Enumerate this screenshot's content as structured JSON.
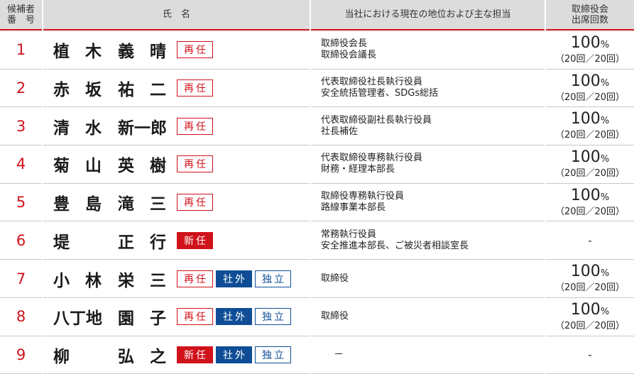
{
  "table": {
    "headers": {
      "number_line1": "候補者",
      "number_line2": "番　号",
      "name": "氏　名",
      "position": "当社における現在の地位および主な担当",
      "attendance_line1": "取締役会",
      "attendance_line2": "出席回数"
    },
    "rows": [
      {
        "no": "1",
        "name": [
          "植",
          "木",
          "義",
          "晴"
        ],
        "badges": [
          {
            "type": "reappoint",
            "label": "再任"
          }
        ],
        "position": [
          "取締役会長",
          "取締役会議長"
        ],
        "attendance": {
          "percent": "100",
          "unit": "%",
          "count": "（20回／20回）"
        }
      },
      {
        "no": "2",
        "name": [
          "赤",
          "坂",
          "祐",
          "二"
        ],
        "badges": [
          {
            "type": "reappoint",
            "label": "再任"
          }
        ],
        "position": [
          "代表取締役社長執行役員",
          "安全統括管理者、SDGs総括"
        ],
        "attendance": {
          "percent": "100",
          "unit": "%",
          "count": "（20回／20回）"
        }
      },
      {
        "no": "3",
        "name": [
          "清",
          "水",
          "新一郎"
        ],
        "badges": [
          {
            "type": "reappoint",
            "label": "再任"
          }
        ],
        "position": [
          "代表取締役副社長執行役員",
          "社長補佐"
        ],
        "attendance": {
          "percent": "100",
          "unit": "%",
          "count": "（20回／20回）"
        }
      },
      {
        "no": "4",
        "name": [
          "菊",
          "山",
          "英",
          "樹"
        ],
        "badges": [
          {
            "type": "reappoint",
            "label": "再任"
          }
        ],
        "position": [
          "代表取締役専務執行役員",
          "財務・経理本部長"
        ],
        "attendance": {
          "percent": "100",
          "unit": "%",
          "count": "（20回／20回）"
        }
      },
      {
        "no": "5",
        "name": [
          "豊",
          "島",
          "滝",
          "三"
        ],
        "badges": [
          {
            "type": "reappoint",
            "label": "再任"
          }
        ],
        "position": [
          "取締役専務執行役員",
          "路線事業本部長"
        ],
        "attendance": {
          "percent": "100",
          "unit": "%",
          "count": "（20回／20回）"
        }
      },
      {
        "no": "6",
        "name": [
          "堤",
          "",
          "正",
          "行"
        ],
        "badges": [
          {
            "type": "new",
            "label": "新任"
          }
        ],
        "position": [
          "常務執行役員",
          "安全推進本部長、ご被災者相談室長"
        ],
        "attendance": {
          "dash": "-"
        }
      },
      {
        "no": "7",
        "name": [
          "小",
          "林",
          "栄",
          "三"
        ],
        "badges": [
          {
            "type": "reappoint",
            "label": "再任"
          },
          {
            "type": "outside",
            "label": "社外"
          },
          {
            "type": "indep",
            "label": "独立"
          }
        ],
        "position": [
          "取締役"
        ],
        "attendance": {
          "percent": "100",
          "unit": "%",
          "count": "（20回／20回）"
        }
      },
      {
        "no": "8",
        "name": [
          "八丁地",
          "",
          "園",
          "子"
        ],
        "badges": [
          {
            "type": "reappoint",
            "label": "再任"
          },
          {
            "type": "outside",
            "label": "社外"
          },
          {
            "type": "indep",
            "label": "独立"
          }
        ],
        "position": [
          "取締役"
        ],
        "attendance": {
          "percent": "100",
          "unit": "%",
          "count": "（20回／20回）"
        }
      },
      {
        "no": "9",
        "name": [
          "柳",
          "",
          "弘",
          "之"
        ],
        "badges": [
          {
            "type": "new",
            "label": "新任"
          },
          {
            "type": "outside",
            "label": "社外"
          },
          {
            "type": "indep",
            "label": "独立"
          }
        ],
        "position": [
          "－"
        ],
        "attendance": {
          "dash": "-"
        }
      }
    ]
  },
  "colors": {
    "accent_red": "#d0121b",
    "navy": "#0f4e96",
    "header_bg": "#dcdcdc"
  }
}
